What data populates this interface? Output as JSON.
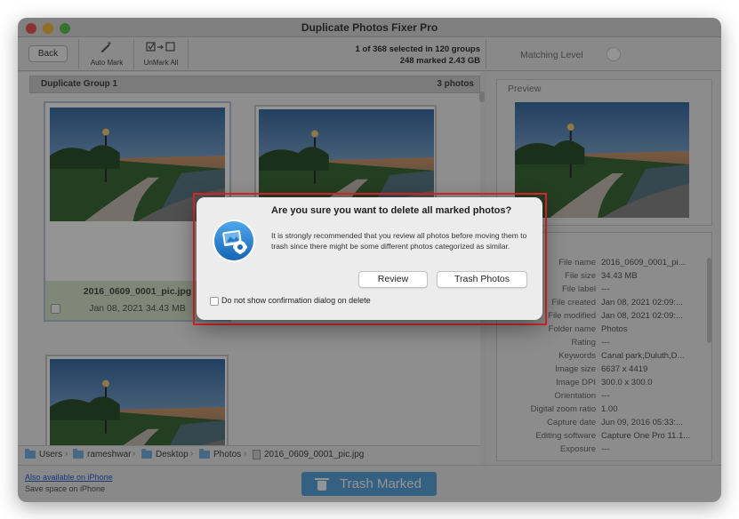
{
  "window": {
    "title": "Duplicate Photos Fixer Pro",
    "traffic_lights": {
      "close": "#ee5b56",
      "minimize": "#f5bd3b",
      "zoom": "#5fc454"
    }
  },
  "toolbar": {
    "back_label": "Back",
    "auto_mark_label": "Auto Mark",
    "auto_mark_icon": "magic-wand-icon",
    "unmark_all_label": "UnMark All",
    "unmark_all_icon": "checkbox-arrow-icon",
    "selection_line1": "1 of 368 selected in 120 groups",
    "selection_line2": "248 marked 2.43 GB",
    "matching_level_label": "Matching Level"
  },
  "group": {
    "name": "Duplicate Group 1",
    "count": "3 photos"
  },
  "thumbnails": [
    {
      "name": "2016_0609_0001_pic.jpg",
      "meta": "Jan 08, 2021  34.43 MB",
      "checked": false,
      "selected": true
    },
    {
      "name": "",
      "meta": "",
      "checked": true,
      "selected": false
    },
    {
      "name": "",
      "meta": "",
      "checked": true,
      "selected": false
    }
  ],
  "path": {
    "items": [
      "Users",
      "rameshwar",
      "Desktop",
      "Photos",
      "2016_0609_0001_pic.jpg"
    ],
    "separator": "›"
  },
  "preview": {
    "label": "Preview"
  },
  "file_info": [
    {
      "key": "File name",
      "value": "2016_0609_0001_pi..."
    },
    {
      "key": "File size",
      "value": "34.43 MB"
    },
    {
      "key": "File label",
      "value": "---"
    },
    {
      "key": "File created",
      "value": "Jan 08, 2021 02:09:..."
    },
    {
      "key": "File modified",
      "value": "Jan 08, 2021 02:09:..."
    },
    {
      "key": "Folder name",
      "value": "Photos"
    },
    {
      "key": "Rating",
      "value": "---"
    },
    {
      "key": "Keywords",
      "value": "Canal park,Duluth,D..."
    },
    {
      "key": "Image size",
      "value": "6637 x 4419"
    },
    {
      "key": "Image DPI",
      "value": "300.0 x 300.0"
    },
    {
      "key": "Orientation",
      "value": "---"
    },
    {
      "key": "Digital zoom ratio",
      "value": "1.00"
    },
    {
      "key": "Capture date",
      "value": "Jun 09, 2016 05:33:..."
    },
    {
      "key": "Editing software",
      "value": "Capture One Pro 11.1..."
    },
    {
      "key": "Exposure",
      "value": "---"
    }
  ],
  "bottom": {
    "iphone_link": "Also available on iPhone",
    "iphone_sub": "Save space on iPhone",
    "trash_marked_label": "Trash Marked",
    "trash_color": "#5aa8df"
  },
  "dialog": {
    "title": "Are you sure you want to delete all marked photos?",
    "message": "It is strongly recommended that you review all photos before moving them to trash since there might be some different photos categorized as similar.",
    "review_label": "Review",
    "trash_label": "Trash Photos",
    "checkbox_label": "Do not show confirmation dialog on delete",
    "checkbox_checked": false,
    "annotation_color": "#e0262b"
  }
}
